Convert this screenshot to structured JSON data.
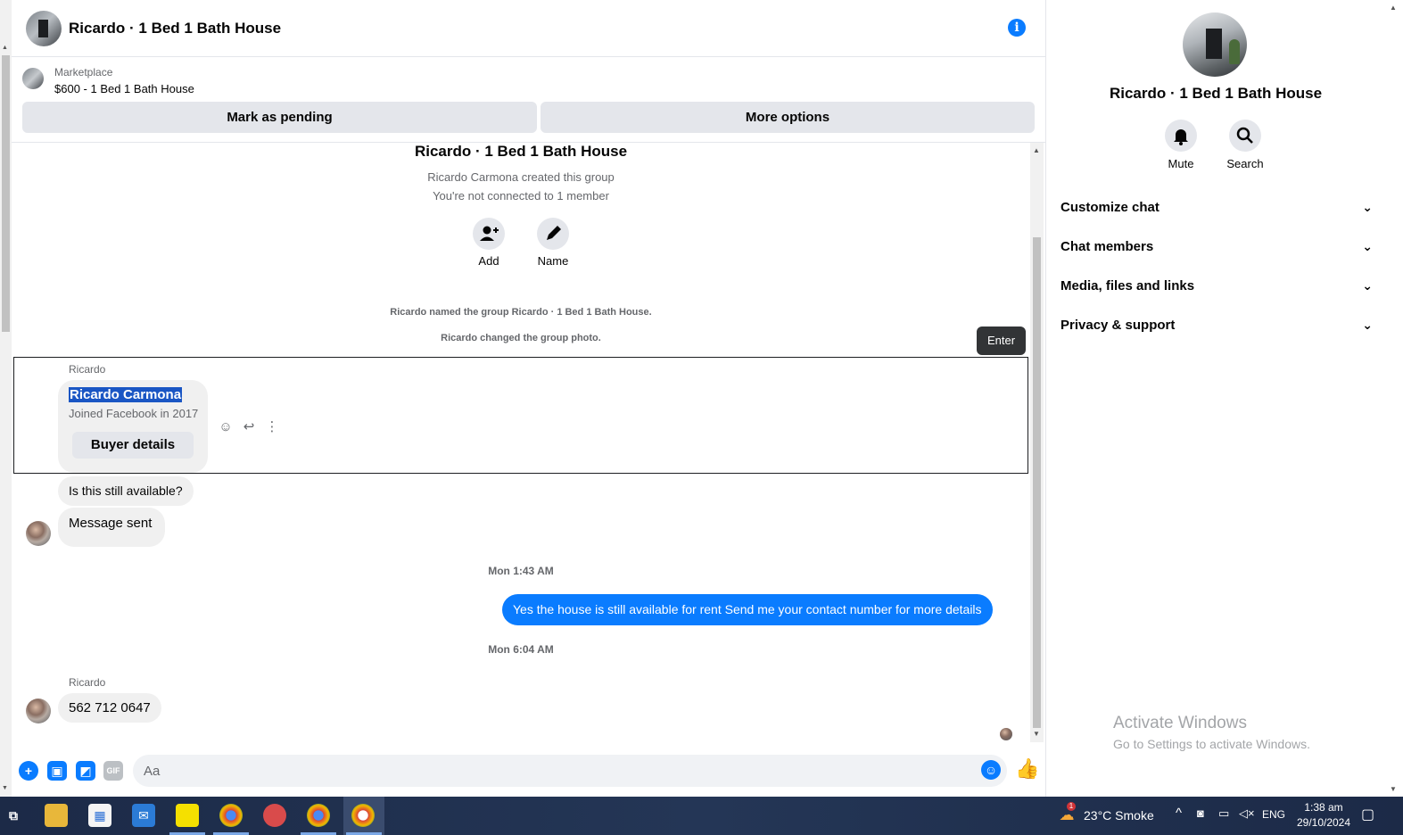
{
  "chat_header": {
    "title": "Ricardo · 1 Bed 1 Bath House"
  },
  "marketplace": {
    "label": "Marketplace",
    "listing": "$600 - 1 Bed 1 Bath House",
    "pending_label": "Mark as pending",
    "more_label": "More options"
  },
  "thread": {
    "group_title": "Ricardo · 1 Bed 1 Bath House",
    "created": "Ricardo Carmona created this group",
    "connection": "You're not connected to 1 member",
    "add_label": "Add",
    "name_label": "Name",
    "system_1": "Ricardo named the group Ricardo · 1 Bed 1 Bath House.",
    "system_2": "Ricardo changed the group photo.",
    "tooltip": "Enter",
    "sender_1": "Ricardo",
    "card_name": "Ricardo Carmona",
    "card_sub": "Joined Facebook in 2017",
    "card_button": "Buyer details",
    "msg_1": "Is this still available?",
    "msg_2": "Message sent",
    "time_1": "Mon 1:43 AM",
    "out_msg": "Yes the house is still available for rent Send me your contact number for more details",
    "time_2": "Mon 6:04 AM",
    "sender_2": "Ricardo",
    "msg_3": "562 712 0647"
  },
  "composer": {
    "placeholder": "Aa"
  },
  "panel": {
    "title": "Ricardo · 1 Bed 1 Bath House",
    "mute_label": "Mute",
    "search_label": "Search",
    "rows": [
      {
        "label": "Customize chat"
      },
      {
        "label": "Chat members"
      },
      {
        "label": "Media, files and links"
      },
      {
        "label": "Privacy & support"
      }
    ],
    "watermark_title": "Activate Windows",
    "watermark_sub": "Go to Settings to activate Windows."
  },
  "taskbar": {
    "weather": "23°C  Smoke",
    "weather_badge": "1",
    "lang": "ENG",
    "time": "1:38 am",
    "date": "29/10/2024"
  },
  "colors": {
    "accent": "#0a7cff",
    "bubble_in": "#f0f0f0",
    "taskbar": "#202f4e"
  }
}
